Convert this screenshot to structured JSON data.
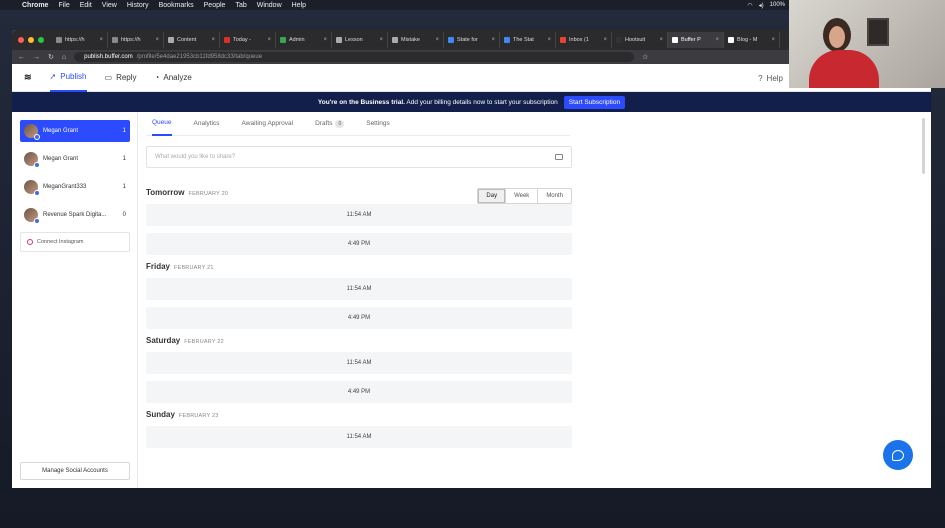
{
  "menubar": {
    "app": "Chrome",
    "items": [
      "File",
      "Edit",
      "View",
      "History",
      "Bookmarks",
      "People",
      "Tab",
      "Window",
      "Help"
    ],
    "battery": "100%"
  },
  "browser": {
    "tabs": [
      {
        "label": "https://h",
        "color": "#888888"
      },
      {
        "label": "https://h",
        "color": "#888888"
      },
      {
        "label": "Content",
        "color": "#aaaaaa"
      },
      {
        "label": "Today -",
        "color": "#d93025"
      },
      {
        "label": "Admin",
        "color": "#34a853"
      },
      {
        "label": "Lesson",
        "color": "#aaaaaa"
      },
      {
        "label": "Mistake",
        "color": "#aaaaaa"
      },
      {
        "label": "State for",
        "color": "#4285f4"
      },
      {
        "label": "The Stat",
        "color": "#4285f4"
      },
      {
        "label": "Inbox (1",
        "color": "#ea4335"
      },
      {
        "label": "Hootsuit",
        "color": "#333333"
      },
      {
        "label": "Buffer P",
        "color": "#ffffff",
        "active": true
      },
      {
        "label": "Blog - M",
        "color": "#ffffff"
      }
    ],
    "url_host": "publish.buffer.com",
    "url_path": "/profile/5e4dae21953cb11fd958dc33/tab/queue"
  },
  "nav": {
    "publish": "Publish",
    "reply": "Reply",
    "analyze": "Analyze",
    "help": "Help"
  },
  "trial": {
    "bold": "You're on the Business trial.",
    "text": "Add your billing details now to start your subscription",
    "button": "Start Subscription"
  },
  "sidebar": {
    "accounts": [
      {
        "name": "Megan Grant",
        "count": "1",
        "active": true
      },
      {
        "name": "Megan Grant",
        "count": "1"
      },
      {
        "name": "MeganGrant333",
        "count": "1"
      },
      {
        "name": "Revenue Spark Digita...",
        "count": "0"
      }
    ],
    "connect": "Connect Instagram",
    "manage": "Manage Social Accounts"
  },
  "tabs": {
    "queue": "Queue",
    "analytics": "Analytics",
    "awaiting": "Awaiting Approval",
    "drafts": "Drafts",
    "drafts_count": "0",
    "settings": "Settings"
  },
  "composer": {
    "placeholder": "What would you like to share?"
  },
  "view": {
    "day": "Day",
    "week": "Week",
    "month": "Month"
  },
  "schedule": [
    {
      "day": "Tomorrow",
      "date": "FEBRUARY 20",
      "slots": [
        "11:54 AM",
        "4:49 PM"
      ]
    },
    {
      "day": "Friday",
      "date": "FEBRUARY 21",
      "slots": [
        "11:54 AM",
        "4:49 PM"
      ]
    },
    {
      "day": "Saturday",
      "date": "FEBRUARY 22",
      "slots": [
        "11:54 AM",
        "4:49 PM"
      ]
    },
    {
      "day": "Sunday",
      "date": "FEBRUARY 23",
      "slots": [
        "11:54 AM"
      ]
    }
  ]
}
